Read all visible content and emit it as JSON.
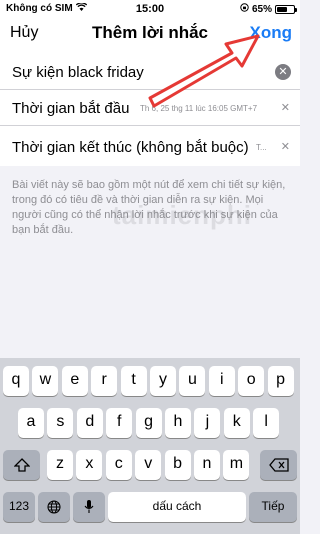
{
  "status_bar": {
    "carrier": "Không có SIM",
    "time": "15:00",
    "battery_percent": "65%",
    "battery_level": 0.65
  },
  "nav": {
    "cancel": "Hủy",
    "title": "Thêm lời nhắc",
    "done": "Xong"
  },
  "form": {
    "title_value": "Sự kiện black friday",
    "start_label": "Thời gian bắt đầu",
    "start_value": "Th 6, 25 thg 11 lúc 16:05 GMT+7",
    "end_label": "Thời gian kết thúc (không bắt buộc)",
    "end_value": "T..."
  },
  "description": "Bài viết này sẽ bao gồm một nút để xem chi tiết sự kiện, trong đó có tiêu đề và thời gian diễn ra sự kiện. Mọi người cũng có thể nhận lời nhắc trước khi sự kiện của bạn bắt đầu.",
  "watermark": "taimienphi",
  "keyboard": {
    "row1": [
      "q",
      "w",
      "e",
      "r",
      "t",
      "y",
      "u",
      "i",
      "o",
      "p"
    ],
    "row2": [
      "a",
      "s",
      "d",
      "f",
      "g",
      "h",
      "j",
      "k",
      "l"
    ],
    "row3": [
      "z",
      "x",
      "c",
      "v",
      "b",
      "n",
      "m"
    ],
    "numbers": "123",
    "space": "dấu cách",
    "return": "Tiếp"
  },
  "colors": {
    "accent": "#1a7cf5",
    "annotation": "#e53935"
  }
}
